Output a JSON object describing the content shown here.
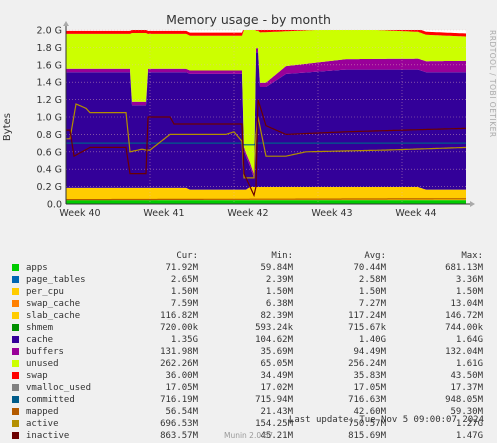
{
  "chart_data": {
    "type": "area",
    "title": "Memory usage - by month",
    "ylabel": "Bytes",
    "side_label": "RRDTOOL / TOBI OETIKER",
    "ylim": [
      0,
      2.0
    ],
    "y_ticks": [
      "0.0",
      "0.2 G",
      "0.4 G",
      "0.6 G",
      "0.8 G",
      "1.0 G",
      "1.2 G",
      "1.4 G",
      "1.6 G",
      "1.8 G",
      "2.0 G"
    ],
    "x_ticks": [
      "Week 40",
      "Week 41",
      "Week 42",
      "Week 43",
      "Week 44"
    ],
    "grid": true,
    "columns": [
      "Cur:",
      "Min:",
      "Avg:",
      "Max:"
    ],
    "series": [
      {
        "name": "apps",
        "color": "#00cc00",
        "cur": "71.92M",
        "min": "59.84M",
        "avg": "70.44M",
        "max": "681.13M"
      },
      {
        "name": "page_tables",
        "color": "#0066b3",
        "cur": "2.65M",
        "min": "2.39M",
        "avg": "2.58M",
        "max": "3.36M"
      },
      {
        "name": "per_cpu",
        "color": "#ffcc00",
        "cur": "1.50M",
        "min": "1.50M",
        "avg": "1.50M",
        "max": "1.50M"
      },
      {
        "name": "swap_cache",
        "color": "#ff8000",
        "cur": "7.59M",
        "min": "6.38M",
        "avg": "7.27M",
        "max": "13.04M"
      },
      {
        "name": "slab_cache",
        "color": "#ffcc00",
        "cur": "116.82M",
        "min": "82.39M",
        "avg": "117.24M",
        "max": "146.72M"
      },
      {
        "name": "shmem",
        "color": "#008f00",
        "cur": "720.00k",
        "min": "593.24k",
        "avg": "715.67k",
        "max": "744.00k"
      },
      {
        "name": "cache",
        "color": "#330099",
        "cur": "1.35G",
        "min": "104.62M",
        "avg": "1.40G",
        "max": "1.64G"
      },
      {
        "name": "buffers",
        "color": "#990099",
        "cur": "131.98M",
        "min": "35.69M",
        "avg": "94.49M",
        "max": "132.04M"
      },
      {
        "name": "unused",
        "color": "#ccff00",
        "cur": "262.26M",
        "min": "65.05M",
        "avg": "256.24M",
        "max": "1.61G"
      },
      {
        "name": "swap",
        "color": "#ff0000",
        "cur": "36.00M",
        "min": "34.49M",
        "avg": "35.83M",
        "max": "43.50M"
      },
      {
        "name": "vmalloc_used",
        "color": "#808080",
        "cur": "17.05M",
        "min": "17.02M",
        "avg": "17.05M",
        "max": "17.37M"
      },
      {
        "name": "committed",
        "color": "#005c8a",
        "cur": "716.19M",
        "min": "715.94M",
        "avg": "716.63M",
        "max": "948.05M"
      },
      {
        "name": "mapped",
        "color": "#b35a00",
        "cur": "56.54M",
        "min": "21.43M",
        "avg": "42.60M",
        "max": "59.30M"
      },
      {
        "name": "active",
        "color": "#b38f00",
        "cur": "696.53M",
        "min": "154.25M",
        "avg": "750.57M",
        "max": "1.27G"
      },
      {
        "name": "inactive",
        "color": "#6b0000",
        "cur": "863.57M",
        "min": "45.21M",
        "avg": "815.69M",
        "max": "1.47G"
      }
    ],
    "last_update": "Last update: Tue Nov  5 09:00:07 2024",
    "version": "Munin 2.0.67"
  }
}
